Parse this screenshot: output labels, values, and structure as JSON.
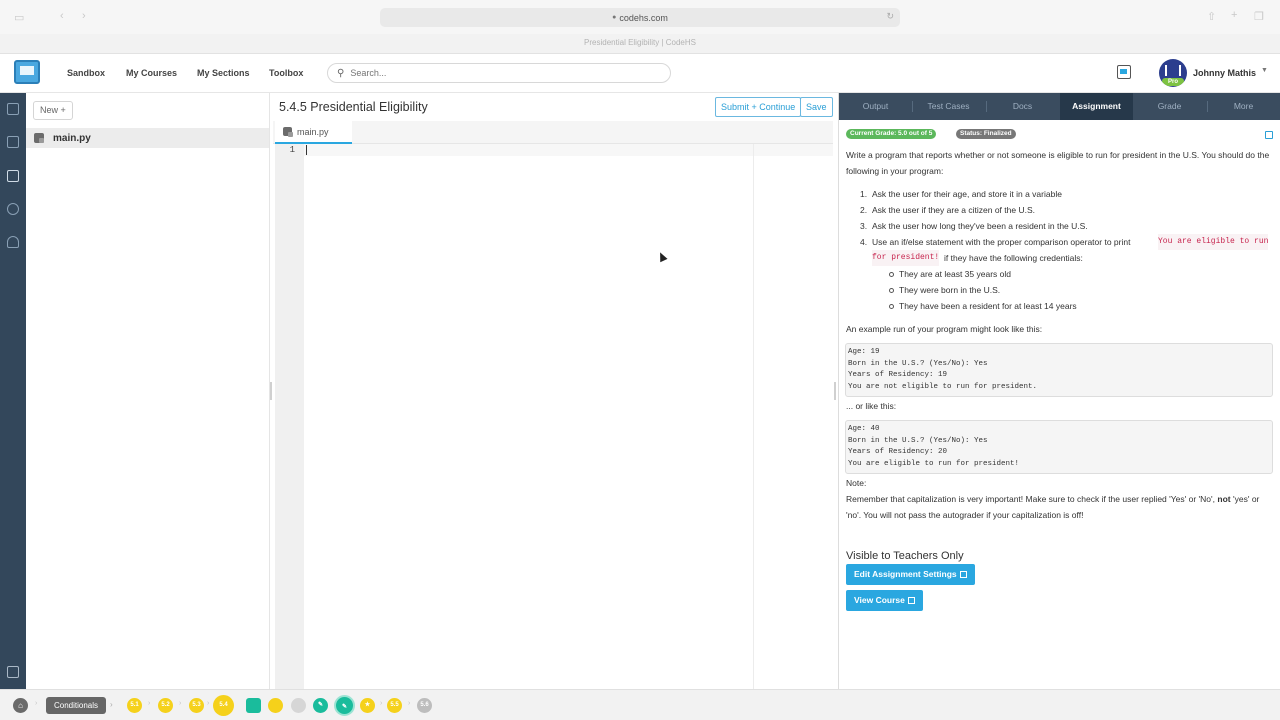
{
  "browser": {
    "url": "codehs.com",
    "tab_title": "Presidential Eligibility | CodeHS"
  },
  "header": {
    "nav": [
      "Sandbox",
      "My Courses",
      "My Sections",
      "Toolbox"
    ],
    "search_placeholder": "Search...",
    "user_name": "Johnny Mathis",
    "avatar_badge": "Pro"
  },
  "filetree": {
    "new_button": "New +",
    "files": [
      "main.py"
    ]
  },
  "editor": {
    "title": "5.4.5 Presidential Eligibility",
    "submit_label": "Submit + Continue",
    "save_label": "Save",
    "tab_label": "main.py",
    "line_number": "1"
  },
  "right_panel": {
    "tabs": [
      "Output",
      "Test Cases",
      "Docs",
      "Assignment",
      "Grade",
      "More"
    ],
    "active_tab": "Assignment",
    "grade_badge": "Current Grade: 5.0 out of 5",
    "status_badge": "Status: Finalized",
    "intro": "Write a program that reports whether or not someone is eligible to run for president in the U.S. You should do the following in your program:",
    "steps": [
      "Ask the user for their age, and store it in a variable",
      "Ask the user if they are a citizen of the U.S.",
      "Ask the user how long they've been a resident in the U.S.",
      "Use an if/else statement with the proper comparison operator to print"
    ],
    "step4_code_a": "You are eligible to run",
    "step4_code_b": "for president!",
    "step4_rest": "if they have the following credentials:",
    "credentials": [
      "They are at least 35 years old",
      "They were born in the U.S.",
      "They have been a resident for at least 14 years"
    ],
    "example_intro": "An example run of your program might look like this:",
    "example1": [
      "Age: 19",
      "Born in the U.S.? (Yes/No): Yes",
      "Years of Residency: 19",
      "You are not eligible to run for president."
    ],
    "or_like_this": "... or like this:",
    "example2": [
      "Age: 40",
      "Born in the U.S.? (Yes/No): Yes",
      "Years of Residency: 20",
      "You are eligible to run for president!"
    ],
    "note_label": "Note:",
    "note_a": "Remember that capitalization is very important! Make sure to check if the user replied 'Yes' or 'No',",
    "note_bold": "not",
    "note_b": "'yes' or 'no'. You will not pass the autograder if your capitalization is off!",
    "teachers_heading": "Visible to Teachers Only",
    "edit_settings": "Edit Assignment Settings",
    "view_course": "View Course"
  },
  "bottom_bar": {
    "unit_label": "Conditionals",
    "items": [
      "5.1",
      "5.2",
      "5.3",
      "5.4",
      "",
      "",
      "",
      "",
      "",
      "",
      "5.5",
      "5.6"
    ]
  },
  "colors": {
    "accent": "#2aa7e0",
    "nav_dark": "#33475b",
    "tab_active": "#26384a",
    "grade_green": "#5cb85c",
    "status_gray": "#777777",
    "progress_yellow": "#f5d11b"
  }
}
